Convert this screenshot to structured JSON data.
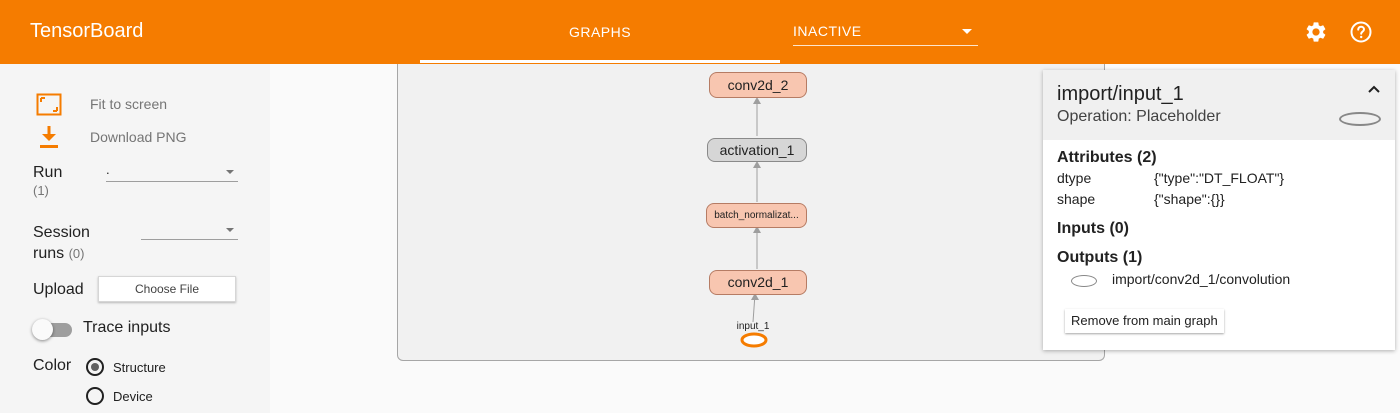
{
  "header": {
    "brand": "TensorBoard",
    "tab_graphs": "GRAPHS",
    "inactive_label": "INACTIVE",
    "accent_color": "#f57c00"
  },
  "sidebar": {
    "fit_to_screen": "Fit to screen",
    "download_png": "Download PNG",
    "run_label": "Run",
    "run_count": "(1)",
    "run_value": ".",
    "session_label_line1": "Session",
    "session_label_line2": "runs",
    "session_count": "(0)",
    "session_value": "",
    "upload_label": "Upload",
    "choose_file": "Choose File",
    "trace_inputs": "Trace inputs",
    "color_label": "Color",
    "color_options": [
      "Structure",
      "Device"
    ],
    "color_selected": "Structure"
  },
  "graph": {
    "nodes": {
      "conv2d_2": "conv2d_2",
      "activation_1": "activation_1",
      "batch_norm": "batch_normalizat...",
      "conv2d_1": "conv2d_1",
      "input_1": "input_1"
    },
    "input_oval_color": "#f57c00"
  },
  "info": {
    "title": "import/input_1",
    "operation": "Operation: Placeholder",
    "attributes_title": "Attributes (2)",
    "attributes": [
      {
        "key": "dtype",
        "value": "{\"type\":\"DT_FLOAT\"}"
      },
      {
        "key": "shape",
        "value": "{\"shape\":{}}"
      }
    ],
    "inputs_title": "Inputs (0)",
    "outputs_title": "Outputs (1)",
    "output_name": "import/conv2d_1/convolution",
    "remove_button": "Remove from main graph"
  }
}
